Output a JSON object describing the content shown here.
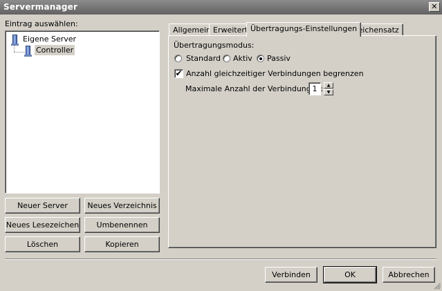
{
  "window": {
    "title": "Servermanager",
    "close_glyph": "✕"
  },
  "left": {
    "select_label": "Eintrag auswählen:",
    "tree": {
      "root": "Eigene Server",
      "child": "Controller"
    },
    "buttons": {
      "new_server": "Neuer Server",
      "new_folder": "Neues Verzeichnis",
      "new_bookmark": "Neues Lesezeichen",
      "rename": "Umbenennen",
      "delete": "Löschen",
      "copy": "Kopieren"
    }
  },
  "tabs": [
    {
      "label": "Allgemein",
      "active": false
    },
    {
      "label": "Erweitert",
      "active": false
    },
    {
      "label": "Übertragungs-Einstellungen",
      "active": true
    },
    {
      "label": "Zeichensatz",
      "active": false
    }
  ],
  "transfer": {
    "mode_label": "Übertragungsmodus:",
    "modes": [
      {
        "label": "Standard",
        "selected": false
      },
      {
        "label": "Aktiv",
        "selected": false
      },
      {
        "label": "Passiv",
        "selected": true
      }
    ],
    "limit_checkbox_label": "Anzahl gleichzeitiger Verbindungen begrenzen",
    "limit_checked": true,
    "max_connections_label": "Maximale Anzahl der Verbindungen:",
    "max_connections_value": "1"
  },
  "footer": {
    "connect": "Verbinden",
    "ok": "OK",
    "cancel": "Abbrechen"
  },
  "icons": {
    "server": "server-icon",
    "check": "✔",
    "spin_up": "▲",
    "spin_down": "▼"
  }
}
